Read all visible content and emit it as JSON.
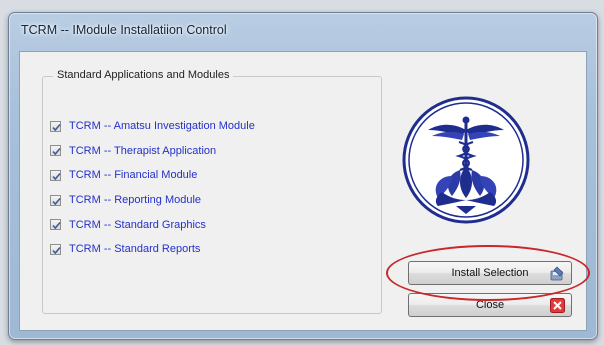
{
  "window": {
    "title": "TCRM -- IModule Installatiion Control"
  },
  "group": {
    "legend": "Standard Applications and Modules",
    "items": [
      {
        "label": "TCRM -- Amatsu Investigation Module",
        "checked": true
      },
      {
        "label": "TCRM -- Therapist Application",
        "checked": true
      },
      {
        "label": "TCRM -- Financial Module",
        "checked": true
      },
      {
        "label": "TCRM -- Reporting Module",
        "checked": true
      },
      {
        "label": "TCRM -- Standard Graphics",
        "checked": true
      },
      {
        "label": "TCRM -- Standard Reports",
        "checked": true
      }
    ]
  },
  "buttons": {
    "install_label": "Install Selection",
    "install_icon": "install-disk-icon",
    "close_label": "Close",
    "close_icon": "close-x-icon"
  },
  "colors": {
    "item_text": "#2431c9",
    "logo_blue": "#1f2d8f",
    "highlight_oval": "#c8282a",
    "close_icon_red": "#e2393a"
  }
}
